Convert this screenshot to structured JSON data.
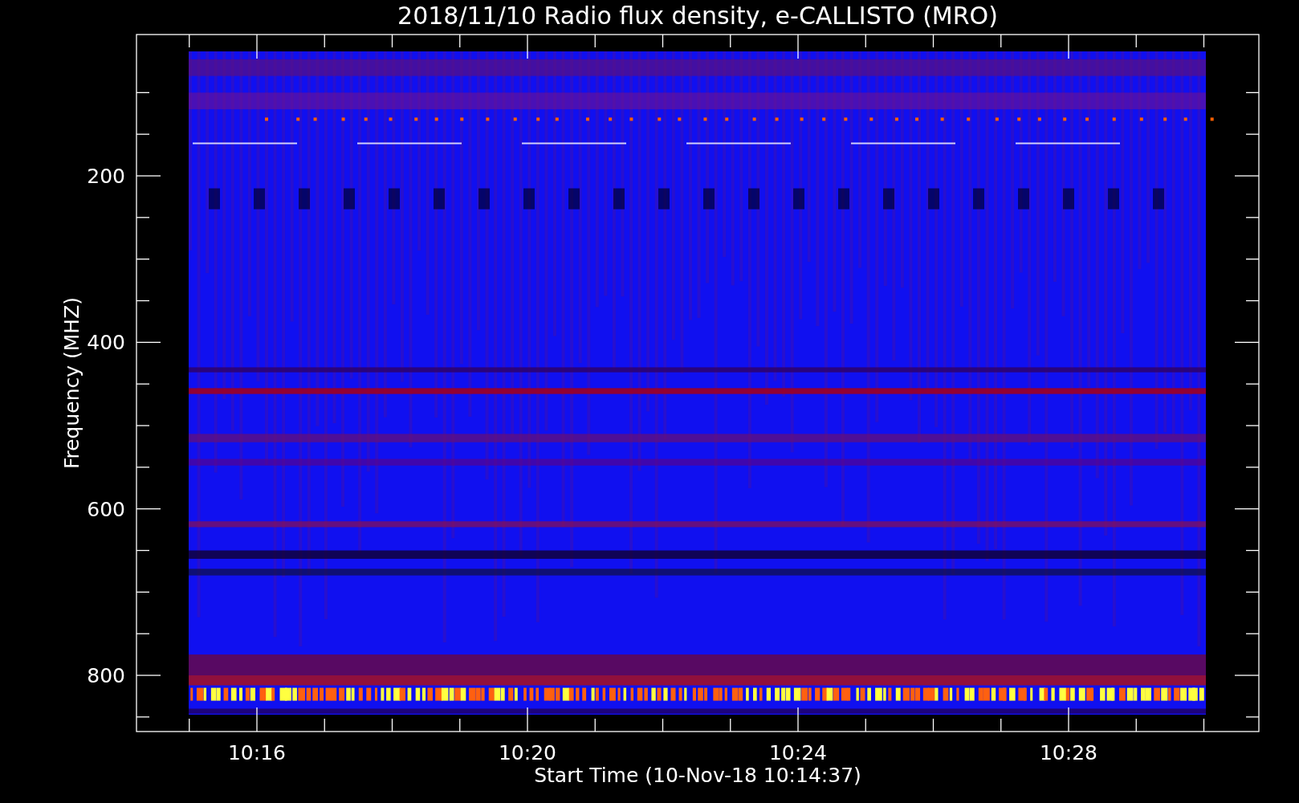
{
  "title": "2018/11/10  Radio flux density, e-CALLISTO (MRO)",
  "y_axis": {
    "label": "Frequency (MHZ)",
    "ticks": [
      "200",
      "400",
      "600",
      "800"
    ]
  },
  "x_axis": {
    "label": "Start Time (10-Nov-18 10:14:37)",
    "ticks": [
      "10:16",
      "10:20",
      "10:24",
      "10:28"
    ]
  }
}
